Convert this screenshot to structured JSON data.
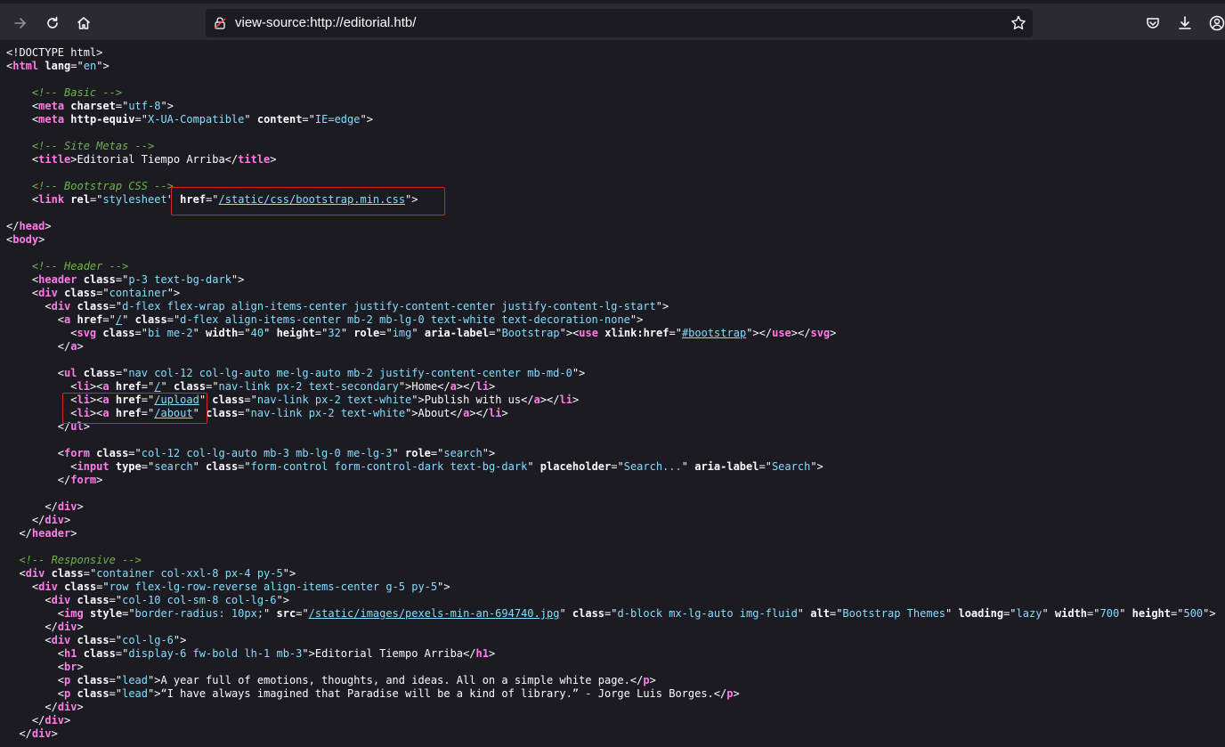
{
  "browser": {
    "url": "view-source:http://editorial.htb/",
    "icons": [
      "forward-icon",
      "reload-icon",
      "home-icon",
      "lock-warning-icon",
      "star-icon",
      "pocket-icon",
      "download-icon",
      "account-icon"
    ]
  },
  "source": {
    "lines": [
      "<!DOCTYPE html>",
      "<html lang=\"en\">",
      "",
      "    <!-- Basic -->",
      "    <meta charset=\"utf-8\">",
      "    <meta http-equiv=\"X-UA-Compatible\" content=\"IE=edge\">",
      "",
      "    <!-- Site Metas -->",
      "    <title>Editorial Tiempo Arriba</title>",
      "",
      "    <!-- Bootstrap CSS -->",
      "    <link rel=\"stylesheet\" href=\"/static/css/bootstrap.min.css\">",
      "",
      "</head>",
      "<body>",
      "",
      "    <!-- Header -->",
      "    <header class=\"p-3 text-bg-dark\">",
      "    <div class=\"container\">",
      "      <div class=\"d-flex flex-wrap align-items-center justify-content-center justify-content-lg-start\">",
      "        <a href=\"/\" class=\"d-flex align-items-center mb-2 mb-lg-0 text-white text-decoration-none\">",
      "          <svg class=\"bi me-2\" width=\"40\" height=\"32\" role=\"img\" aria-label=\"Bootstrap\"><use xlink:href=\"#bootstrap\"></use></svg>",
      "        </a>",
      "",
      "        <ul class=\"nav col-12 col-lg-auto me-lg-auto mb-2 justify-content-center mb-md-0\">",
      "          <li><a href=\"/\" class=\"nav-link px-2 text-secondary\">Home</a></li>",
      "          <li><a href=\"/upload\" class=\"nav-link px-2 text-white\">Publish with us</a></li>",
      "          <li><a href=\"/about\" class=\"nav-link px-2 text-white\">About</a></li>",
      "        </ul>",
      "",
      "        <form class=\"col-12 col-lg-auto mb-3 mb-lg-0 me-lg-3\" role=\"search\">",
      "          <input type=\"search\" class=\"form-control form-control-dark text-bg-dark\" placeholder=\"Search...\" aria-label=\"Search\">",
      "        </form>",
      "",
      "      </div>",
      "    </div>",
      "  </header>",
      "",
      "  <!-- Responsive -->",
      "  <div class=\"container col-xxl-8 px-4 py-5\">",
      "    <div class=\"row flex-lg-row-reverse align-items-center g-5 py-5\">",
      "      <div class=\"col-10 col-sm-8 col-lg-6\">",
      "        <img style=\"border-radius: 10px;\" src=\"/static/images/pexels-min-an-694740.jpg\" class=\"d-block mx-lg-auto img-fluid\" alt=\"Bootstrap Themes\" loading=\"lazy\" width=\"700\" height=\"500\">",
      "      </div>",
      "      <div class=\"col-lg-6\">",
      "        <h1 class=\"display-6 fw-bold lh-1 mb-3\">Editorial Tiempo Arriba</h1>",
      "        <br>",
      "        <p class=\"lead\">A year full of emotions, thoughts, and ideas. All on a simple white page.</p>",
      "        <p class=\"lead\">“I have always imagined that Paradise will be a kind of library.” - Jorge Luis Borges.</p>",
      "      </div>",
      "    </div>",
      "  </div>"
    ],
    "links": [
      "/",
      "/static/css/bootstrap.min.css",
      "#bootstrap",
      "/upload",
      "/about",
      "/static/images/pexels-min-an-694740.jpg"
    ]
  },
  "colors": {
    "background": "#1c1b22",
    "toolbar": "#2b2a33",
    "tag": "#ff7de9",
    "attribute_value": "#86ddff",
    "comment": "#6bb54b",
    "highlight_box": "#d92323"
  }
}
